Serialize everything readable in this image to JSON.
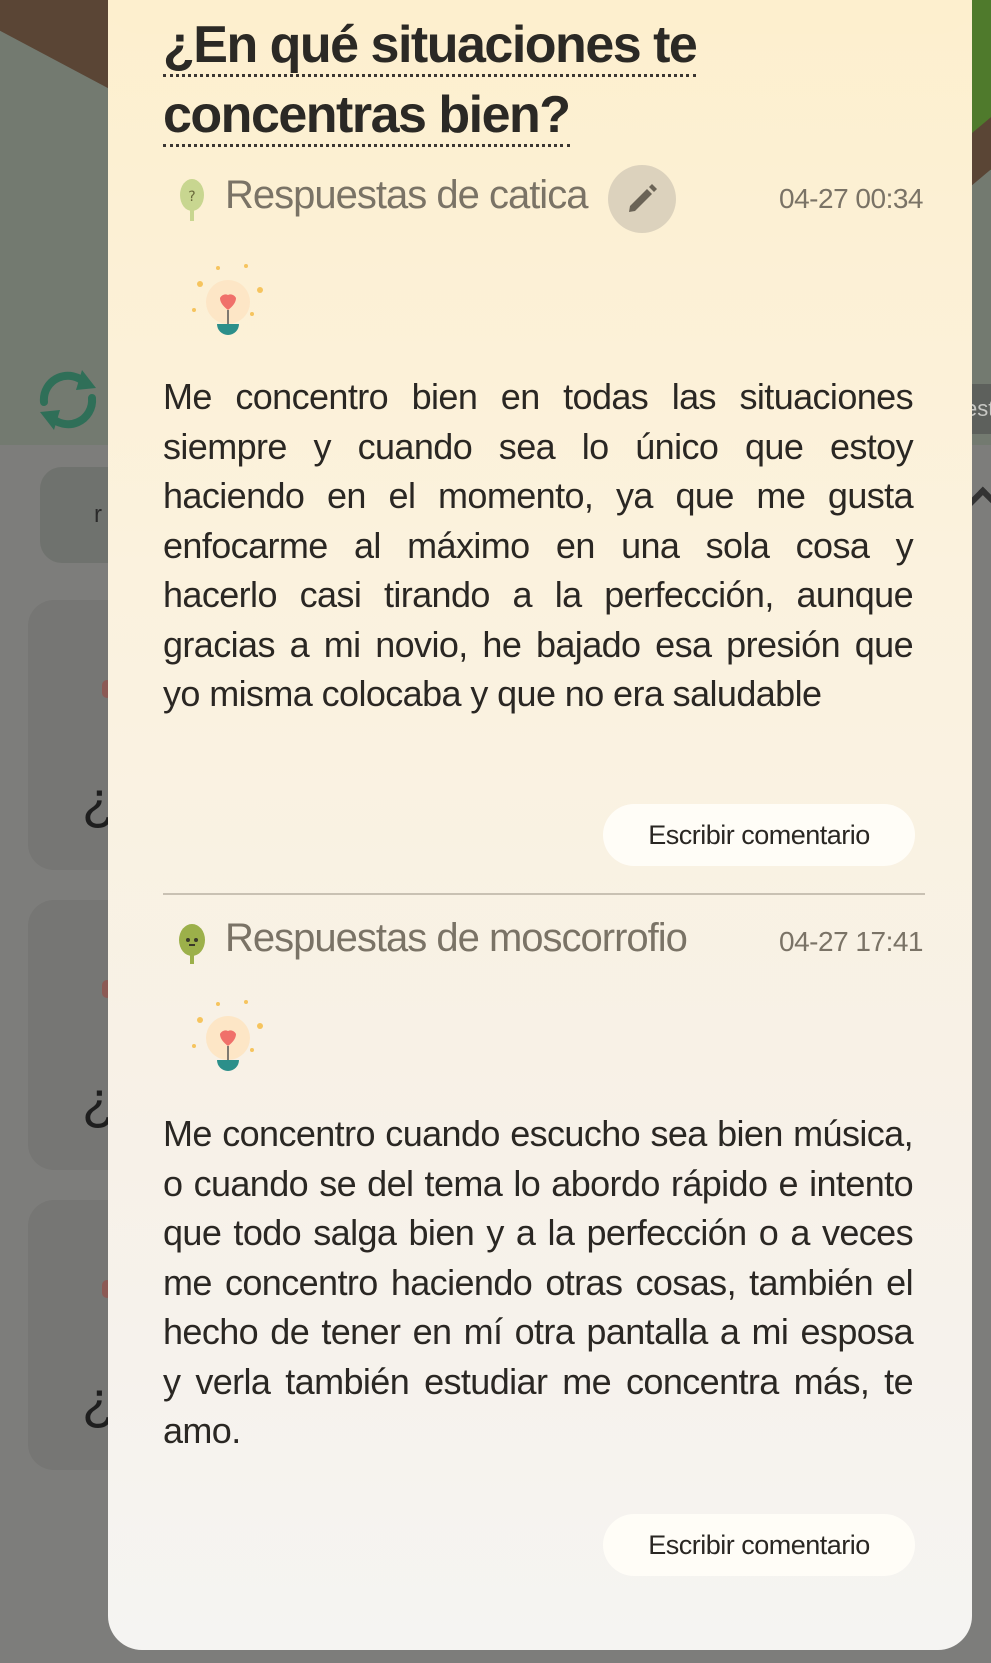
{
  "background": {
    "side_tab_text": "est",
    "pill_text": "r",
    "question_glyph": "¿",
    "card_glyphs": [
      "¿C",
      "¿I",
      "¿C"
    ]
  },
  "question": {
    "title": "¿En qué situaciones te concentras bien?"
  },
  "answers": [
    {
      "author": "Respuestas de catica",
      "timestamp": "04-27 00:34",
      "text": "Me concentro bien en todas las situaciones siempre y cuando sea lo único que estoy haciendo en el momento, ya que me gusta enfocarme al máximo en una sola cosa y hacerlo casi tirando a la perfección, aunque gracias a mi novio, he bajado esa presión que yo misma colocaba y que no era saludable",
      "comment_label": "Escribir comentario",
      "editable": true,
      "avatar_icon": "tree-question-icon"
    },
    {
      "author": "Respuestas de moscorrofio",
      "timestamp": "04-27 17:41",
      "text": "Me concentro cuando escucho sea bien música, o cuando se del tema lo abordo rápido e intento que todo salga bien y a la perfección o a veces me concentro haciendo otras cosas, también el hecho de tener en mí otra pantalla a mi esposa y verla también estudiar me concentra más, te amo.",
      "comment_label": "Escribir comentario",
      "editable": false,
      "avatar_icon": "tree-character-icon"
    }
  ],
  "colors": {
    "modal_top": "#fdefce",
    "modal_bottom": "#f5f4f2",
    "author_text": "#7a7366",
    "body_text": "#2a2723",
    "refresh_green": "#2f8a6a",
    "bulb_heart": "#f0706a",
    "bulb_base": "#2c8f8a"
  }
}
